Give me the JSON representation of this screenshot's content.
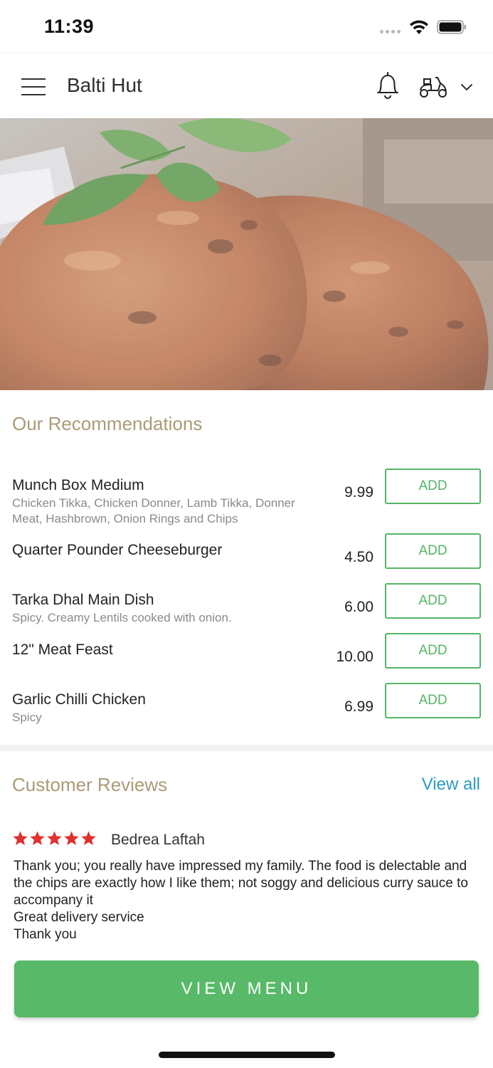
{
  "status_bar": {
    "time": "11:39"
  },
  "header": {
    "title": "Balti Hut",
    "icons": [
      "menu-icon",
      "bell-icon",
      "scooter-icon",
      "chevron-down-icon"
    ]
  },
  "hero": {
    "image": "tandoori-chicken-photo"
  },
  "recommendations": {
    "title": "Our Recommendations",
    "items": [
      {
        "name": "Munch Box Medium",
        "description": "Chicken Tikka, Chicken Donner, Lamb Tikka, Donner Meat, Hashbrown, Onion Rings and Chips",
        "price": "9.99",
        "button": "ADD"
      },
      {
        "name": "Quarter Pounder Cheeseburger",
        "description": "",
        "price": "4.50",
        "button": "ADD"
      },
      {
        "name": "Tarka Dhal Main Dish",
        "description": "Spicy. Creamy Lentils cooked with onion.",
        "price": "6.00",
        "button": "ADD"
      },
      {
        "name": "12\" Meat Feast",
        "description": "",
        "price": "10.00",
        "button": "ADD"
      },
      {
        "name": "Garlic Chilli Chicken",
        "description": "Spicy",
        "price": "6.99",
        "button": "ADD"
      }
    ]
  },
  "reviews": {
    "title": "Customer Reviews",
    "view_all": "View all",
    "review": {
      "rating": 5,
      "reviewer": "Bedrea Laftah",
      "text": "Thank you; you really have impressed my family. The food is delectable and the chips are exactly how I like them; not soggy and delicious curry sauce to accompany it\nGreat delivery service\nThank you"
    }
  },
  "cta": {
    "label": "VIEW MENU"
  },
  "colors": {
    "accent_green": "#58b968",
    "section_title": "#ab9a77",
    "link_blue": "#2a9bc4",
    "star_red": "#e03030"
  }
}
